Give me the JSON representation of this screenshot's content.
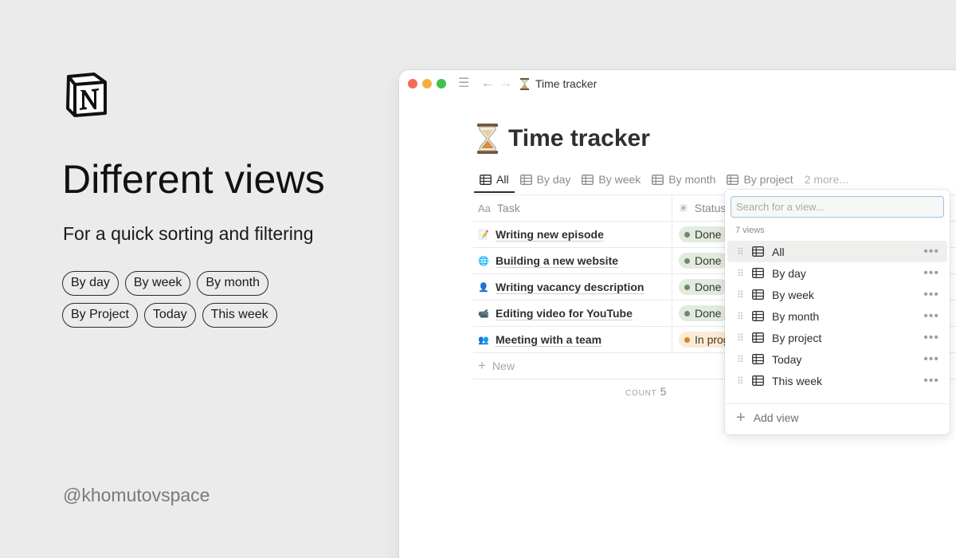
{
  "promo": {
    "headline": "Different views",
    "subline": "For a quick sorting and filtering",
    "chips_row1": [
      "By day",
      "By week",
      "By month"
    ],
    "chips_row2": [
      "By Project",
      "Today",
      "This week"
    ],
    "handle": "@khomutovspace"
  },
  "window": {
    "breadcrumb_title": "Time tracker",
    "page_title": "Time tracker",
    "tabs": [
      {
        "label": "All",
        "active": true
      },
      {
        "label": "By day"
      },
      {
        "label": "By week"
      },
      {
        "label": "By month"
      },
      {
        "label": "By project"
      }
    ],
    "more_tabs": "2 more...",
    "table": {
      "col_task_prefix": "Aa",
      "col_task": "Task",
      "col_status": "Status",
      "rows": [
        {
          "emoji": "📝",
          "task": "Writing new episode",
          "status": "Done"
        },
        {
          "emoji": "🌐",
          "task": "Building a new website",
          "status": "Done"
        },
        {
          "emoji": "👤",
          "task": "Writing vacancy description",
          "status": "Done"
        },
        {
          "emoji": "📹",
          "task": "Editing video for YouTube",
          "status": "Done"
        },
        {
          "emoji": "👥",
          "task": "Meeting with a team",
          "status": "In prog"
        }
      ],
      "new_label": "New",
      "count_label": "COUNT",
      "count_value": "5"
    }
  },
  "dropdown": {
    "search_placeholder": "Search for a view...",
    "count_label": "7 views",
    "items": [
      "All",
      "By day",
      "By week",
      "By month",
      "By project",
      "Today",
      "This week"
    ],
    "selected_index": 0,
    "add_view": "Add view"
  },
  "colors": {
    "done_bg": "#e3eadf",
    "progress_bg": "#fbecd6",
    "search_focus": "#9cc2e6"
  }
}
